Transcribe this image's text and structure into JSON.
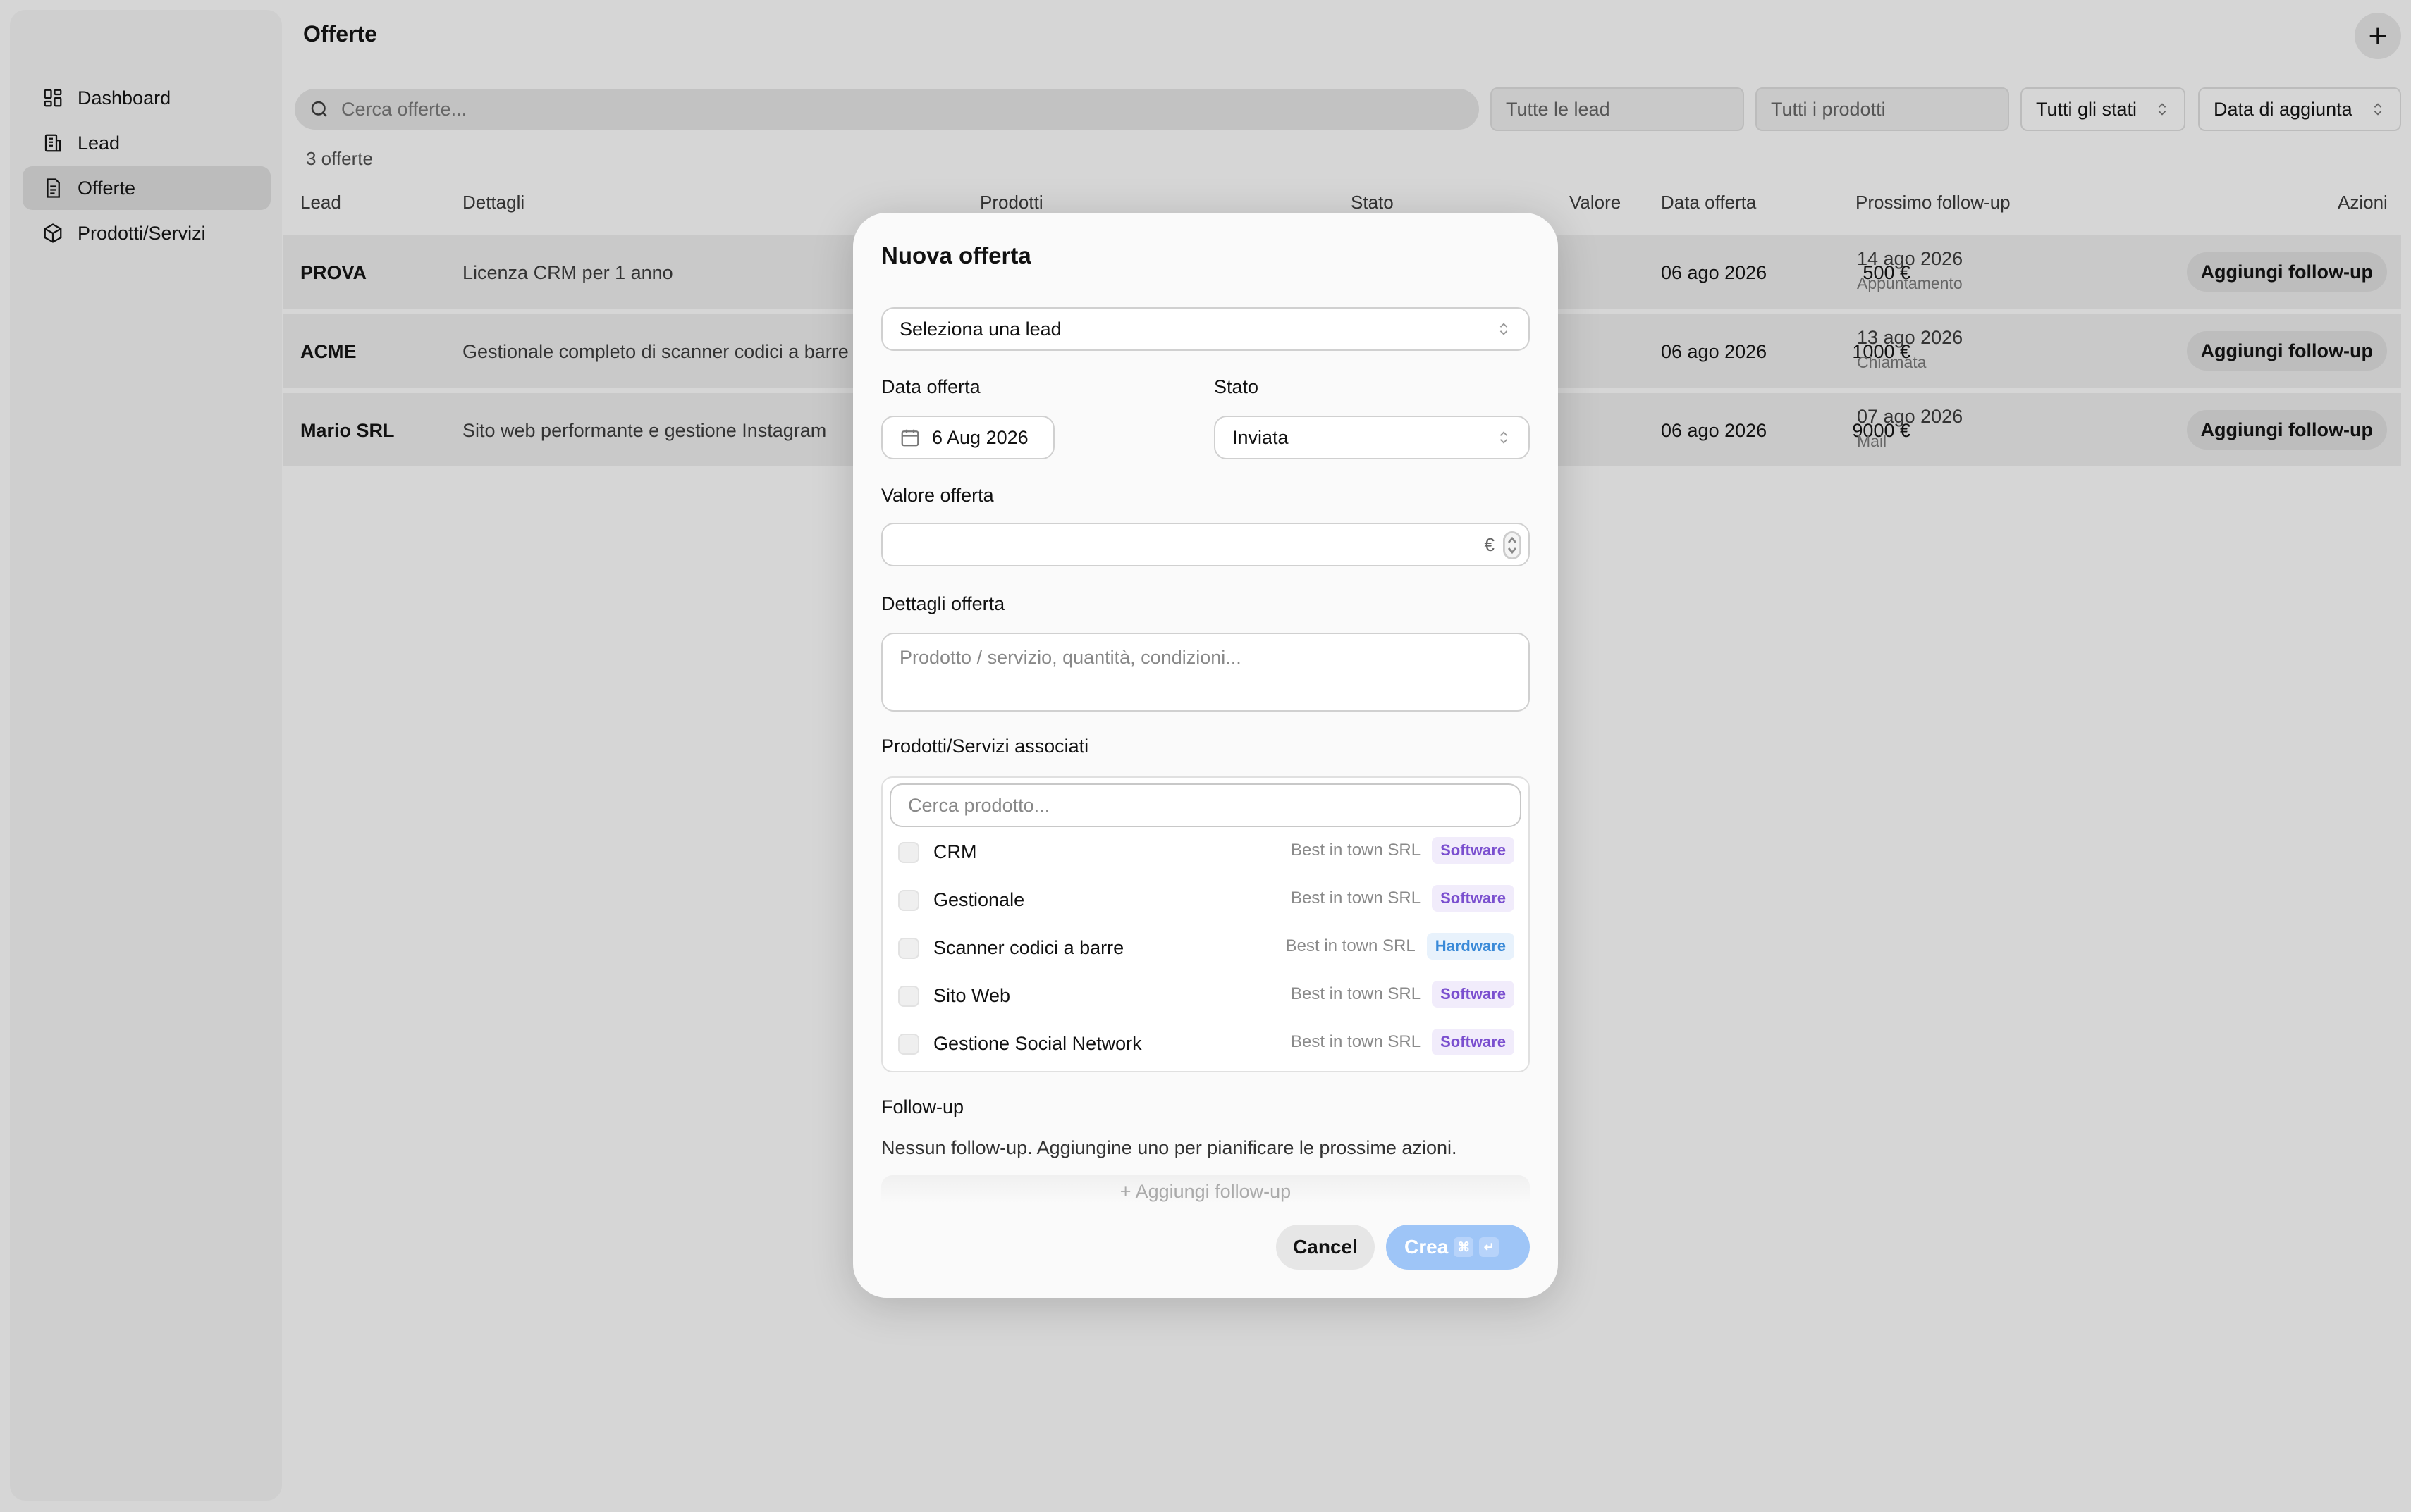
{
  "sidebar": {
    "items": [
      {
        "label": "Dashboard",
        "icon": "dashboard-icon",
        "active": false
      },
      {
        "label": "Lead",
        "icon": "building-icon",
        "active": false
      },
      {
        "label": "Offerte",
        "icon": "document-icon",
        "active": true
      },
      {
        "label": "Prodotti/Servizi",
        "icon": "box-icon",
        "active": false
      }
    ]
  },
  "header": {
    "title": "Offerte",
    "add_icon": "plus-icon"
  },
  "filters": {
    "search_placeholder": "Cerca offerte...",
    "lead_placeholder": "Tutte le lead",
    "product_placeholder": "Tutti i prodotti",
    "status_value": "Tutti gli stati",
    "sort_value": "Data di aggiunta"
  },
  "count_text": "3 offerte",
  "table": {
    "columns": [
      "Lead",
      "Dettagli",
      "Prodotti",
      "Stato",
      "Valore",
      "Data offerta",
      "Prossimo follow-up",
      "Azioni"
    ],
    "rows": [
      {
        "lead": "PROVA",
        "details": "Licenza CRM per 1 anno",
        "value": "500 €",
        "date": "06 ago 2026",
        "followup_date": "14 ago 2026",
        "followup_type": "Appuntamento",
        "action": "Aggiungi follow-up"
      },
      {
        "lead": "ACME",
        "details": "Gestionale completo di scanner codici a barre",
        "value": "1000 €",
        "date": "06 ago 2026",
        "followup_date": "13 ago 2026",
        "followup_type": "Chiamata",
        "action": "Aggiungi follow-up"
      },
      {
        "lead": "Mario SRL",
        "details": "Sito web performante e gestione Instagram",
        "value": "9000 €",
        "date": "06 ago 2026",
        "followup_date": "07 ago 2026",
        "followup_type": "Mail",
        "action": "Aggiungi follow-up"
      }
    ]
  },
  "modal": {
    "title": "Nuova offerta",
    "lead_select": "Seleziona una lead",
    "date_label": "Data offerta",
    "date_value": "6 Aug 2026",
    "status_label": "Stato",
    "status_value": "Inviata",
    "value_label": "Valore offerta",
    "value_input": "",
    "currency": "€",
    "details_label": "Dettagli offerta",
    "details_placeholder": "Prodotto / servizio, quantità, condizioni...",
    "products_label": "Prodotti/Servizi associati",
    "product_search_placeholder": "Cerca prodotto...",
    "products": [
      {
        "name": "CRM",
        "vendor": "Best in town SRL",
        "category": "Software",
        "checked": false
      },
      {
        "name": "Gestionale",
        "vendor": "Best in town SRL",
        "category": "Software",
        "checked": false
      },
      {
        "name": "Scanner codici a barre",
        "vendor": "Best in town SRL",
        "category": "Hardware",
        "checked": false
      },
      {
        "name": "Sito Web",
        "vendor": "Best in town SRL",
        "category": "Software",
        "checked": false
      },
      {
        "name": "Gestione Social Network",
        "vendor": "Best in town SRL",
        "category": "Software",
        "checked": false
      }
    ],
    "followup_label": "Follow-up",
    "followup_empty": "Nessun follow-up. Aggiungine uno per pianificare le prossime azioni.",
    "followup_add": "Aggiungi follow-up",
    "cancel": "Cancel",
    "create": "Crea",
    "create_kbd": [
      "⌘",
      "↵"
    ]
  },
  "colors": {
    "software_badge": "#7a4fcf",
    "hardware_badge": "#3a8ad8",
    "primary_button": "#9ec5f7"
  }
}
